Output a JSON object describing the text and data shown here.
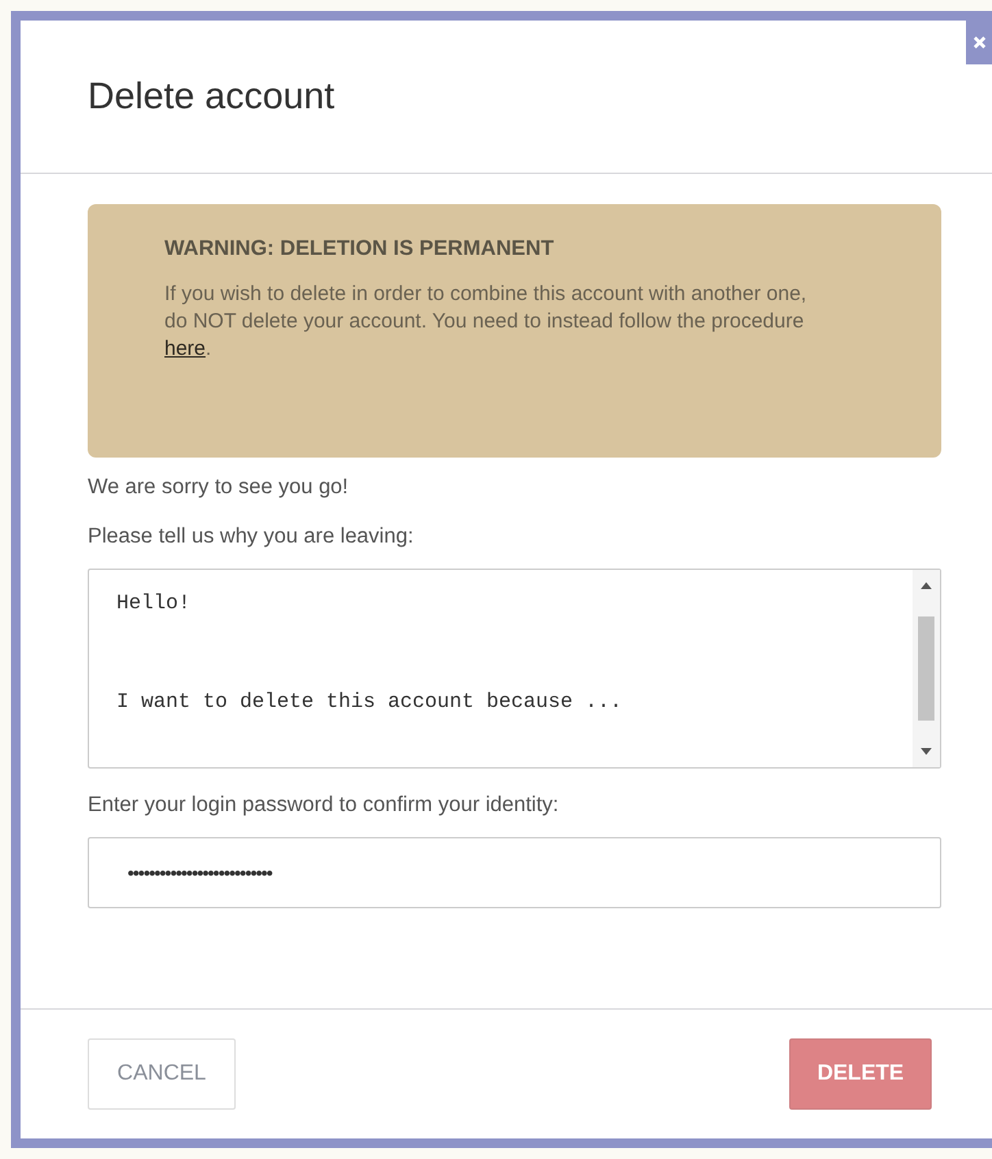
{
  "dialog": {
    "title": "Delete account"
  },
  "warning": {
    "heading": "WARNING: DELETION IS PERMANENT",
    "text": "If you wish to delete in order to combine this account with another one, do NOT delete your account. You need to instead follow the procedure ",
    "link": "here",
    "after_link": "."
  },
  "farewell": "We are sorry to see you go!",
  "reason": {
    "label": "Please tell us why you are leaving:",
    "value": "Hello!\n\n\nI want to delete this account because ..."
  },
  "password": {
    "label": "Enter your login password to confirm your identity:",
    "value": "•••••••••••••••••••••••••••"
  },
  "buttons": [
    {
      "label": "CANCEL",
      "kind": "secondary",
      "disabled": false
    },
    {
      "label": "DELETE",
      "kind": "danger",
      "disabled": true
    }
  ]
}
